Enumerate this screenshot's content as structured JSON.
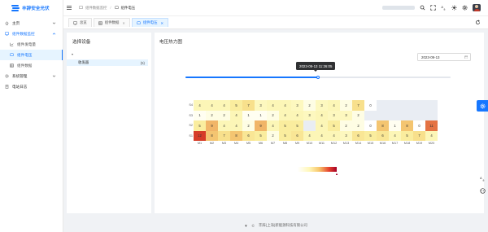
{
  "app": {
    "title": "丰辞安全光伏"
  },
  "sidebar": {
    "items": [
      {
        "label": "主页",
        "icon": "home-icon"
      },
      {
        "label": "组件数据监控",
        "icon": "monitor-icon"
      },
      {
        "label": "组件发电量",
        "icon": "chart-icon"
      },
      {
        "label": "组件电压",
        "icon": "screen-icon"
      },
      {
        "label": "组件数据",
        "icon": "table-icon"
      },
      {
        "label": "系统管理",
        "icon": "gear-icon"
      },
      {
        "label": "电站日志",
        "icon": "log-icon"
      }
    ]
  },
  "header": {
    "breadcrumb": [
      "组件数据监控",
      "组件电压"
    ]
  },
  "tabs": [
    {
      "label": "总览",
      "icon": "monitor-icon"
    },
    {
      "label": "组件数据",
      "icon": "table-icon"
    },
    {
      "label": "组件电压",
      "icon": "screen-icon",
      "active": true
    }
  ],
  "left_panel": {
    "title": "选择设备",
    "tree": {
      "label": "收发器",
      "count": "(5)"
    }
  },
  "right_panel": {
    "title": "电压热力图",
    "date_value": "2023-09-13",
    "slider": {
      "tooltip": "2023-09-13 11:26:05",
      "fraction": 0.5
    }
  },
  "colors": {
    "primary": "#1677ff",
    "heat_scale": [
      "#ffffff",
      "#fff7b8",
      "#f7c66b",
      "#e6442f",
      "#a50026"
    ]
  },
  "chart_data": {
    "type": "heatmap",
    "x_categories": [
      "M1",
      "M2",
      "M3",
      "M4",
      "M5",
      "M6",
      "M7",
      "M8",
      "M9",
      "M10",
      "M11",
      "M12",
      "M13",
      "M14",
      "M15",
      "M16",
      "M17",
      "M18",
      "M19",
      "M20"
    ],
    "y_categories": [
      "S4",
      "S3",
      "S2",
      "S1"
    ],
    "rows": [
      {
        "name": "S4",
        "values": [
          4,
          4,
          4,
          5,
          7,
          3,
          4,
          4,
          3,
          2,
          3,
          4,
          2,
          7,
          0,
          null,
          null,
          null,
          null,
          null
        ]
      },
      {
        "name": "S3",
        "values": [
          1,
          2,
          2,
          4,
          1,
          1,
          2,
          4,
          4,
          3,
          4,
          3,
          3,
          2,
          null,
          null,
          null,
          null,
          null,
          null
        ]
      },
      {
        "name": "S2",
        "values": [
          5,
          9,
          4,
          4,
          2,
          9,
          4,
          5,
          5,
          null,
          4,
          5,
          2,
          2,
          0,
          8,
          1,
          8,
          0,
          11
        ]
      },
      {
        "name": "S1",
        "values": [
          12,
          8,
          7,
          8,
          6,
          5,
          2,
          5,
          6,
          4,
          4,
          4,
          3,
          6,
          5,
          6,
          4,
          5,
          7,
          4
        ]
      }
    ],
    "value_range": [
      0,
      12
    ]
  },
  "footer": {
    "text": "丰辞(上海)新能源科技有限公司"
  }
}
